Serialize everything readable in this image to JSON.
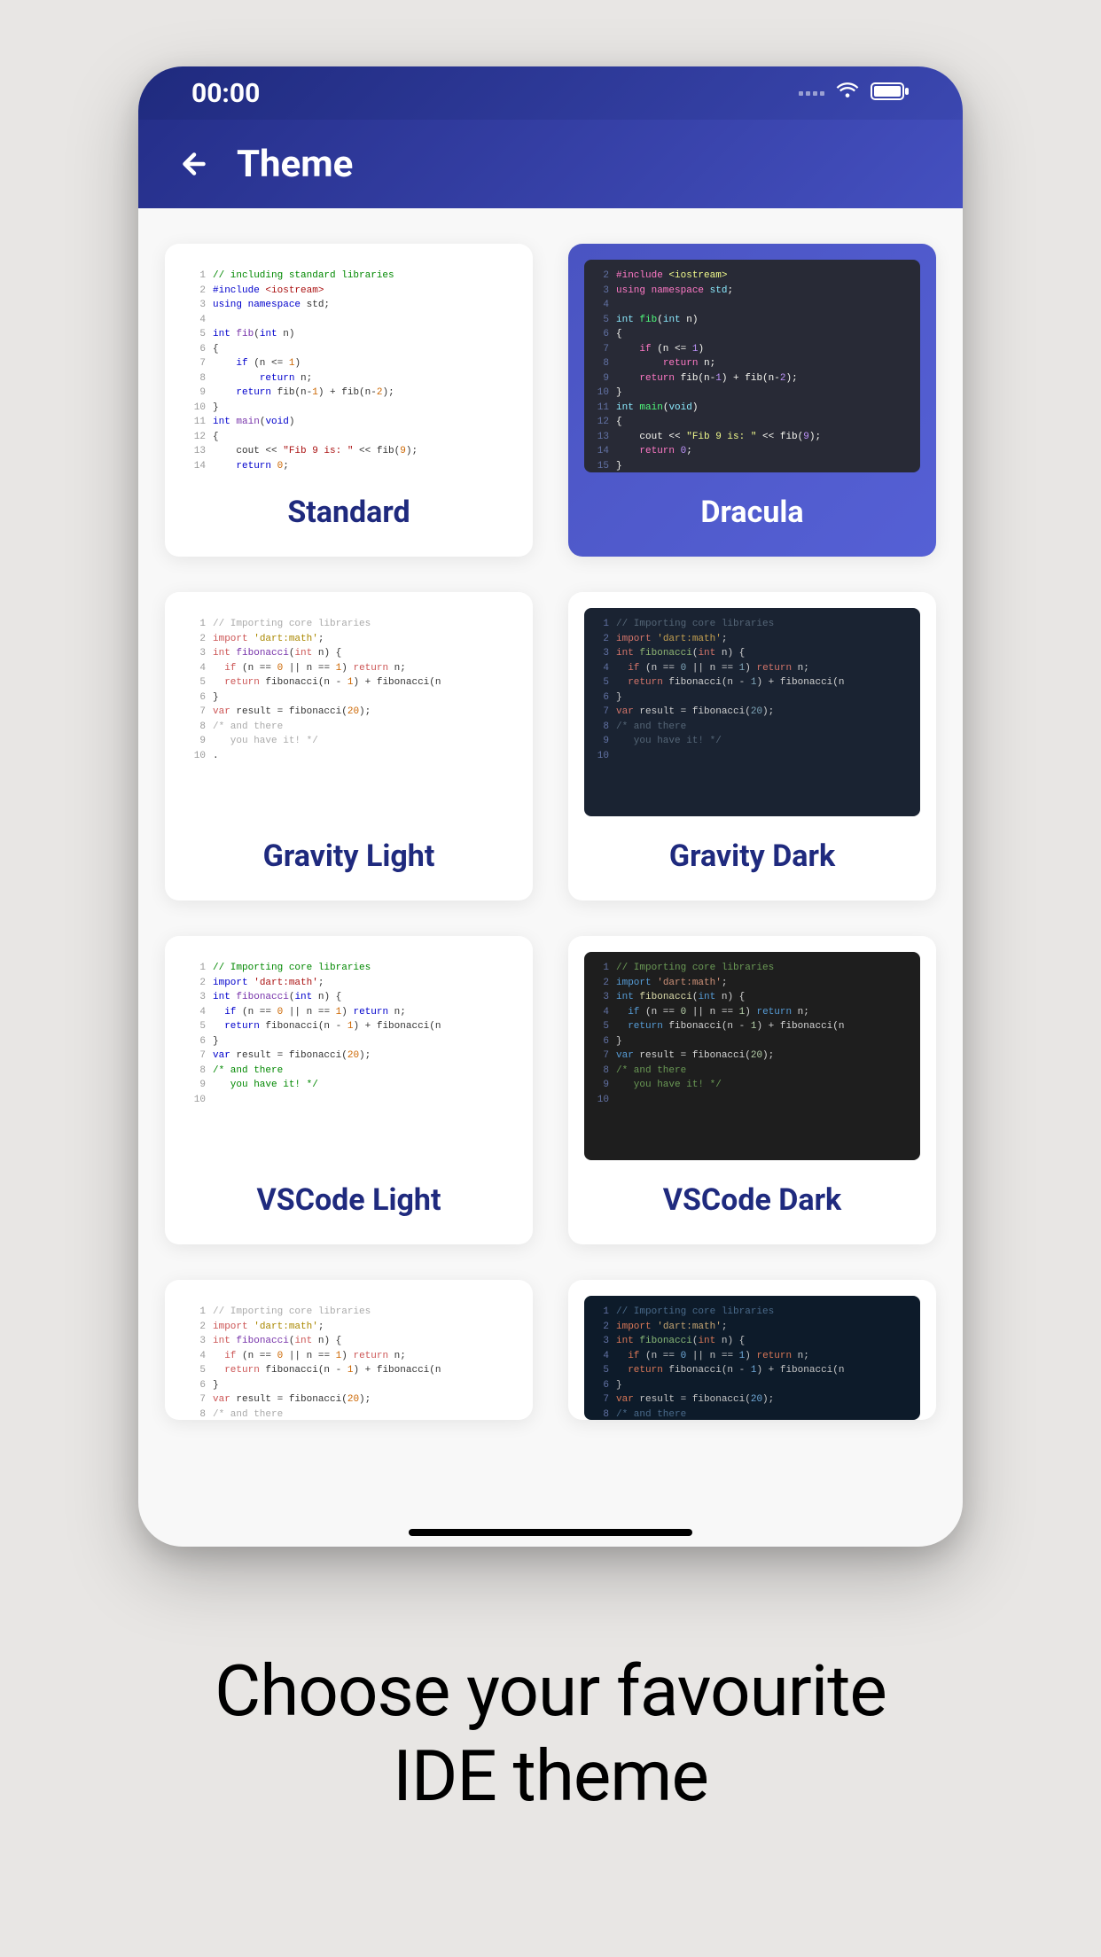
{
  "status": {
    "time": "00:00"
  },
  "header": {
    "title": "Theme"
  },
  "themes": [
    {
      "name": "Standard",
      "selected": false
    },
    {
      "name": "Dracula",
      "selected": true
    },
    {
      "name": "Gravity Light",
      "selected": false
    },
    {
      "name": "Gravity Dark",
      "selected": false
    },
    {
      "name": "VSCode Light",
      "selected": false
    },
    {
      "name": "VSCode Dark",
      "selected": false
    }
  ],
  "code_sample_cpp": {
    "lines": [
      "// including standard libraries",
      "#include <iostream>",
      "using namespace std;",
      "",
      "int fib(int n)",
      "{",
      "    if (n <= 1)",
      "        return n;",
      "    return fib(n-1) + fib(n-2);",
      "}",
      "int main(void)",
      "{",
      "    cout << \"Fib 9 is: \" << fib(9);",
      "    return 0;",
      "}",
      "/* and there",
      "   you have it! */"
    ]
  },
  "code_sample_dart": {
    "lines": [
      "// Importing core libraries",
      "import 'dart:math';",
      "int fibonacci(int n) {",
      "  if (n == 0 || n == 1) return n;",
      "  return fibonacci(n - 1) + fibonacci(n",
      "}",
      "var result = fibonacci(20);",
      "/* and there",
      "   you have it! */",
      "."
    ]
  },
  "tagline": {
    "line1": "Choose your favourite",
    "line2": "IDE theme"
  }
}
